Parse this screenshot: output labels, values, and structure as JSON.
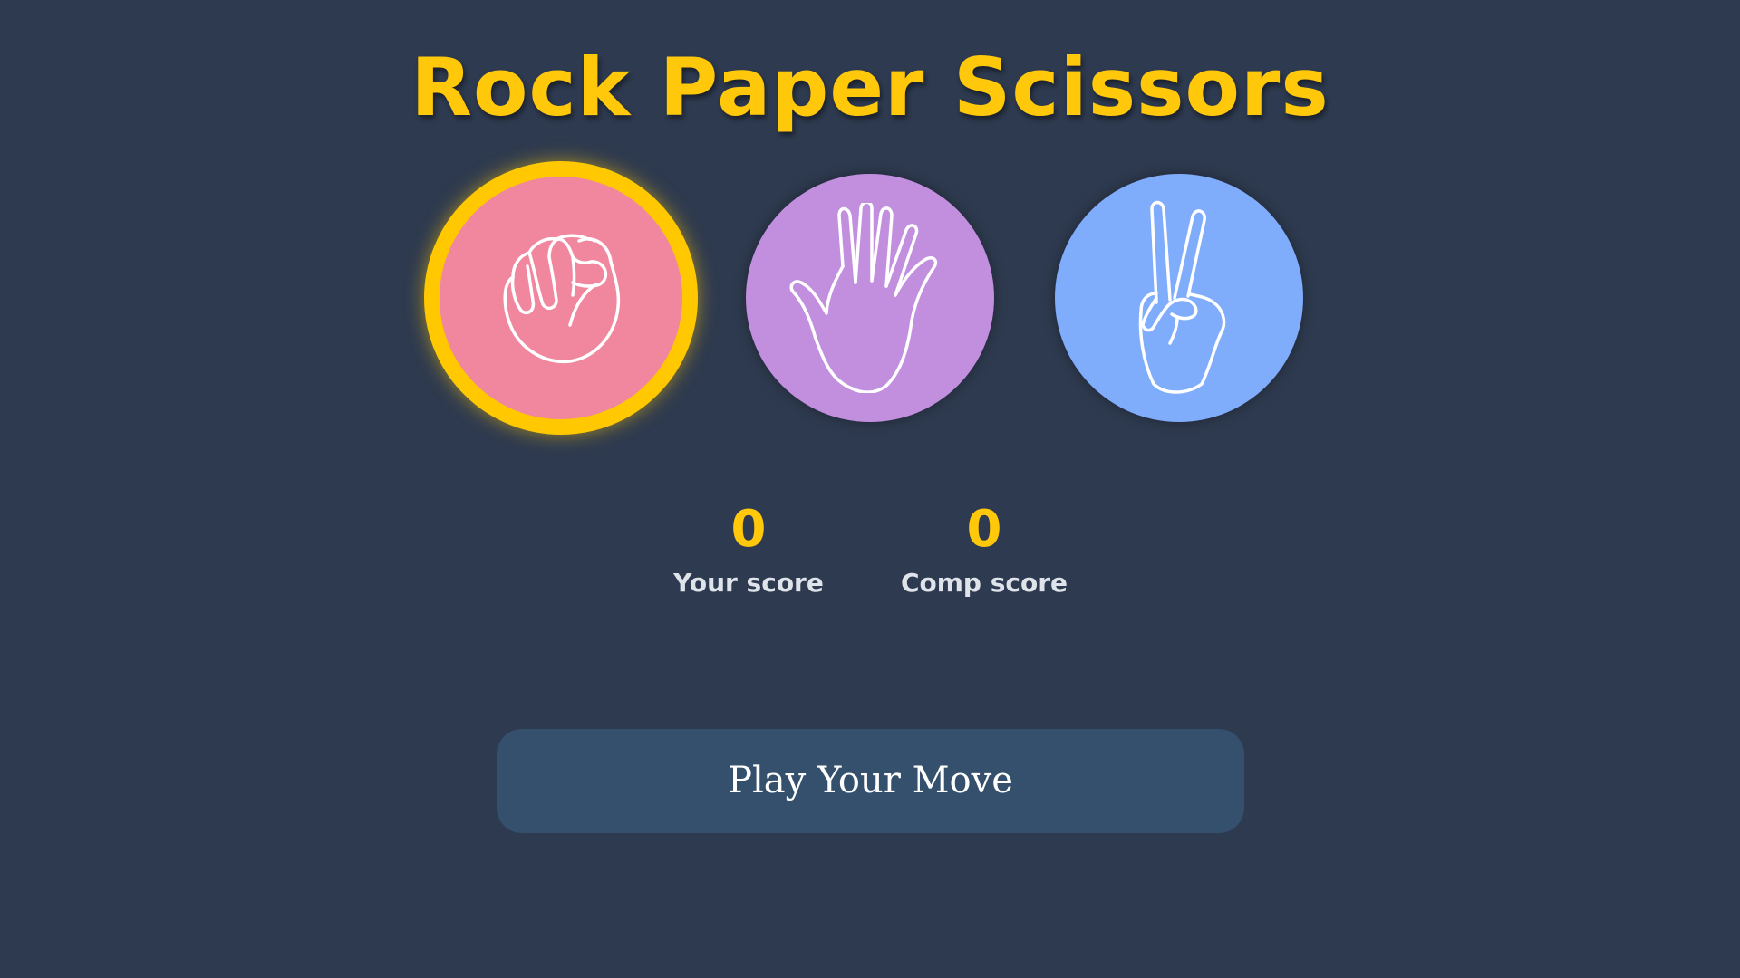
{
  "game": {
    "title": "Rock Paper Scissors",
    "selected_choice": "rock"
  },
  "choices": [
    {
      "id": "rock",
      "icon": "fist-icon",
      "color": "#f0879f"
    },
    {
      "id": "paper",
      "icon": "open-hand-icon",
      "color": "#c28ede"
    },
    {
      "id": "scissors",
      "icon": "peace-hand-icon",
      "color": "#80acfc"
    }
  ],
  "colors": {
    "background": "#2e3a4f",
    "accent": "#ffc80a",
    "button": "#34506c"
  },
  "scoreboard": {
    "user_score": "0",
    "user_label": "Your score",
    "comp_score": "0",
    "comp_label": "Comp score"
  },
  "actions": {
    "play_label": "Play Your Move"
  }
}
